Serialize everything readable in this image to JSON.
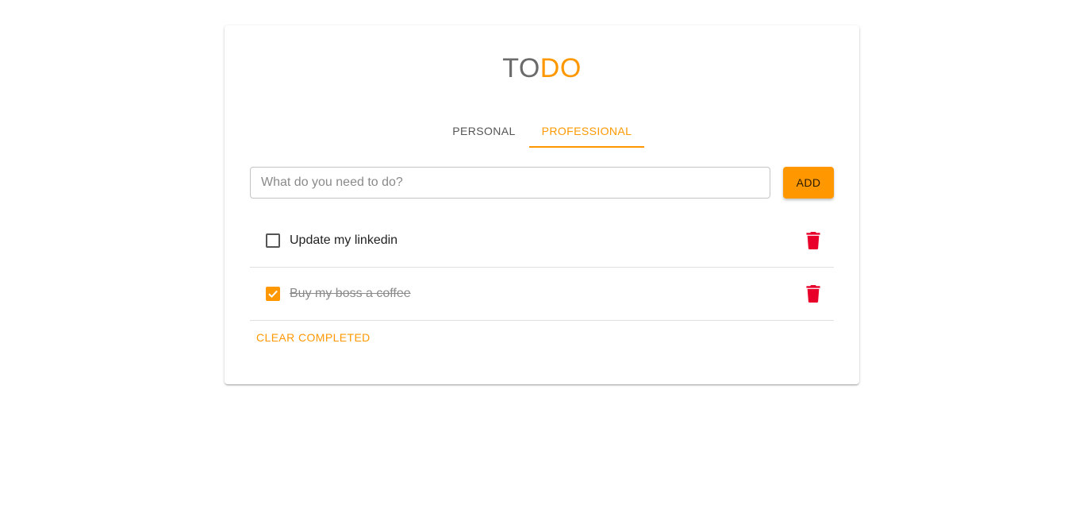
{
  "app": {
    "title_part1": "TO",
    "title_part2": "DO"
  },
  "tabs": [
    {
      "label": "PERSONAL",
      "active": false
    },
    {
      "label": "PROFESSIONAL",
      "active": true
    }
  ],
  "input": {
    "value": "",
    "placeholder": "What do you need to do?"
  },
  "add_button": {
    "label": "ADD"
  },
  "todos": [
    {
      "text": "Update my linkedin",
      "completed": false
    },
    {
      "text": "Buy my boss a coffee",
      "completed": true
    }
  ],
  "clear_button": {
    "label": "CLEAR COMPLETED"
  },
  "icons": {
    "delete": "trash-icon",
    "check": "check-icon"
  },
  "colors": {
    "accent": "#ff9800",
    "delete": "#e8002a",
    "title_gray": "#6b6b6b"
  }
}
